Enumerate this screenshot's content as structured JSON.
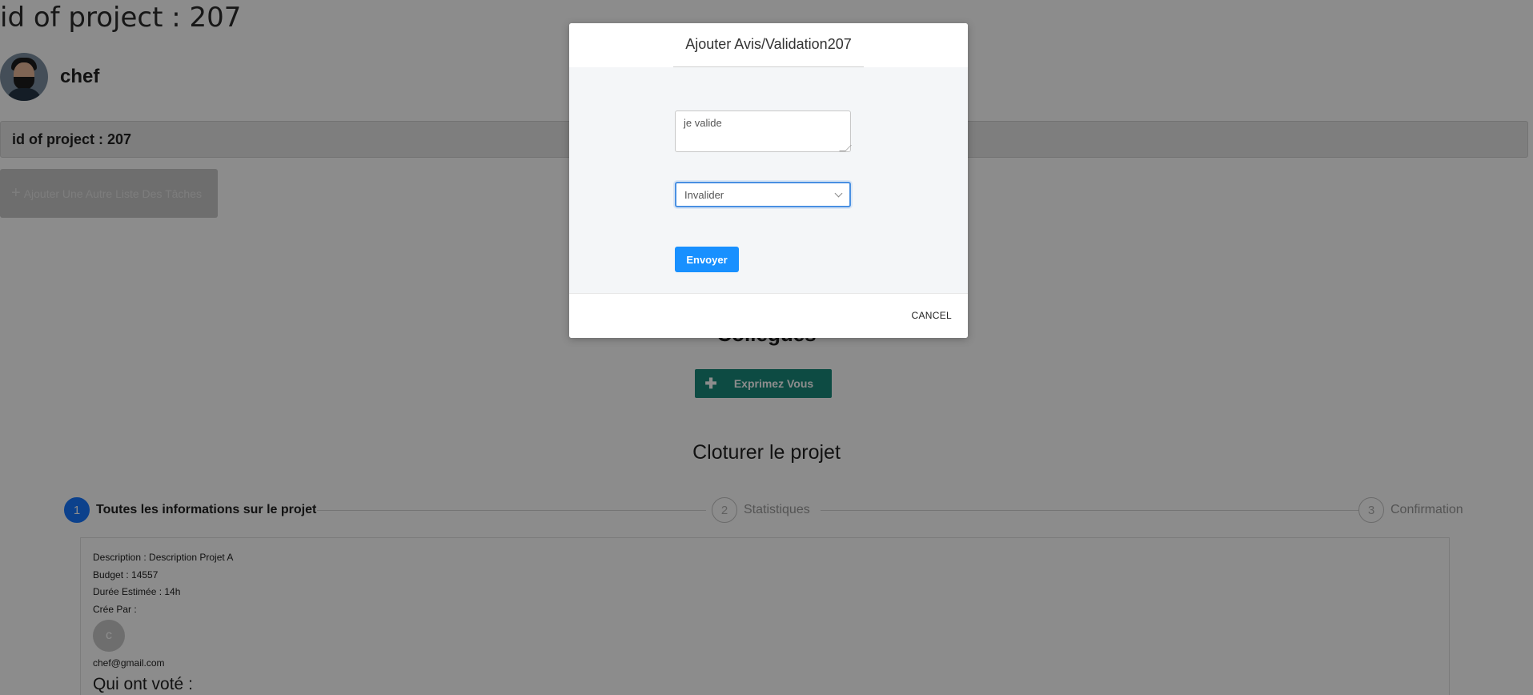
{
  "page": {
    "title": "id of project : 207",
    "user": {
      "name": "chef"
    },
    "id_bar": "id of project : 207",
    "add_list_button": "Ajouter Une Autre Liste Des Tâches",
    "colleagues_title": "Collègues",
    "express_button": "Exprimez Vous",
    "close_title": "Cloturer le projet",
    "steps": [
      {
        "num": "1",
        "label": "Toutes les informations sur le projet"
      },
      {
        "num": "2",
        "label": "Statistiques"
      },
      {
        "num": "3",
        "label": "Confirmation"
      }
    ],
    "info": {
      "description": "Description : Description Projet A",
      "budget": "Budget : 14557",
      "duree": "Durée Estimée : 14h",
      "cree_par": "Crée Par :",
      "creator_initial": "c",
      "creator_email": "chef@gmail.com",
      "voted_title": "Qui ont voté :"
    }
  },
  "modal": {
    "title": "Ajouter Avis/Validation207",
    "textarea_value": "je valide",
    "select_value": "Invalider",
    "send_label": "Envoyer",
    "cancel_label": "CANCEL"
  },
  "colors": {
    "primary": "#1890ff",
    "teal": "#19897b",
    "overlay": "rgba(0,0,0,0.45)"
  }
}
